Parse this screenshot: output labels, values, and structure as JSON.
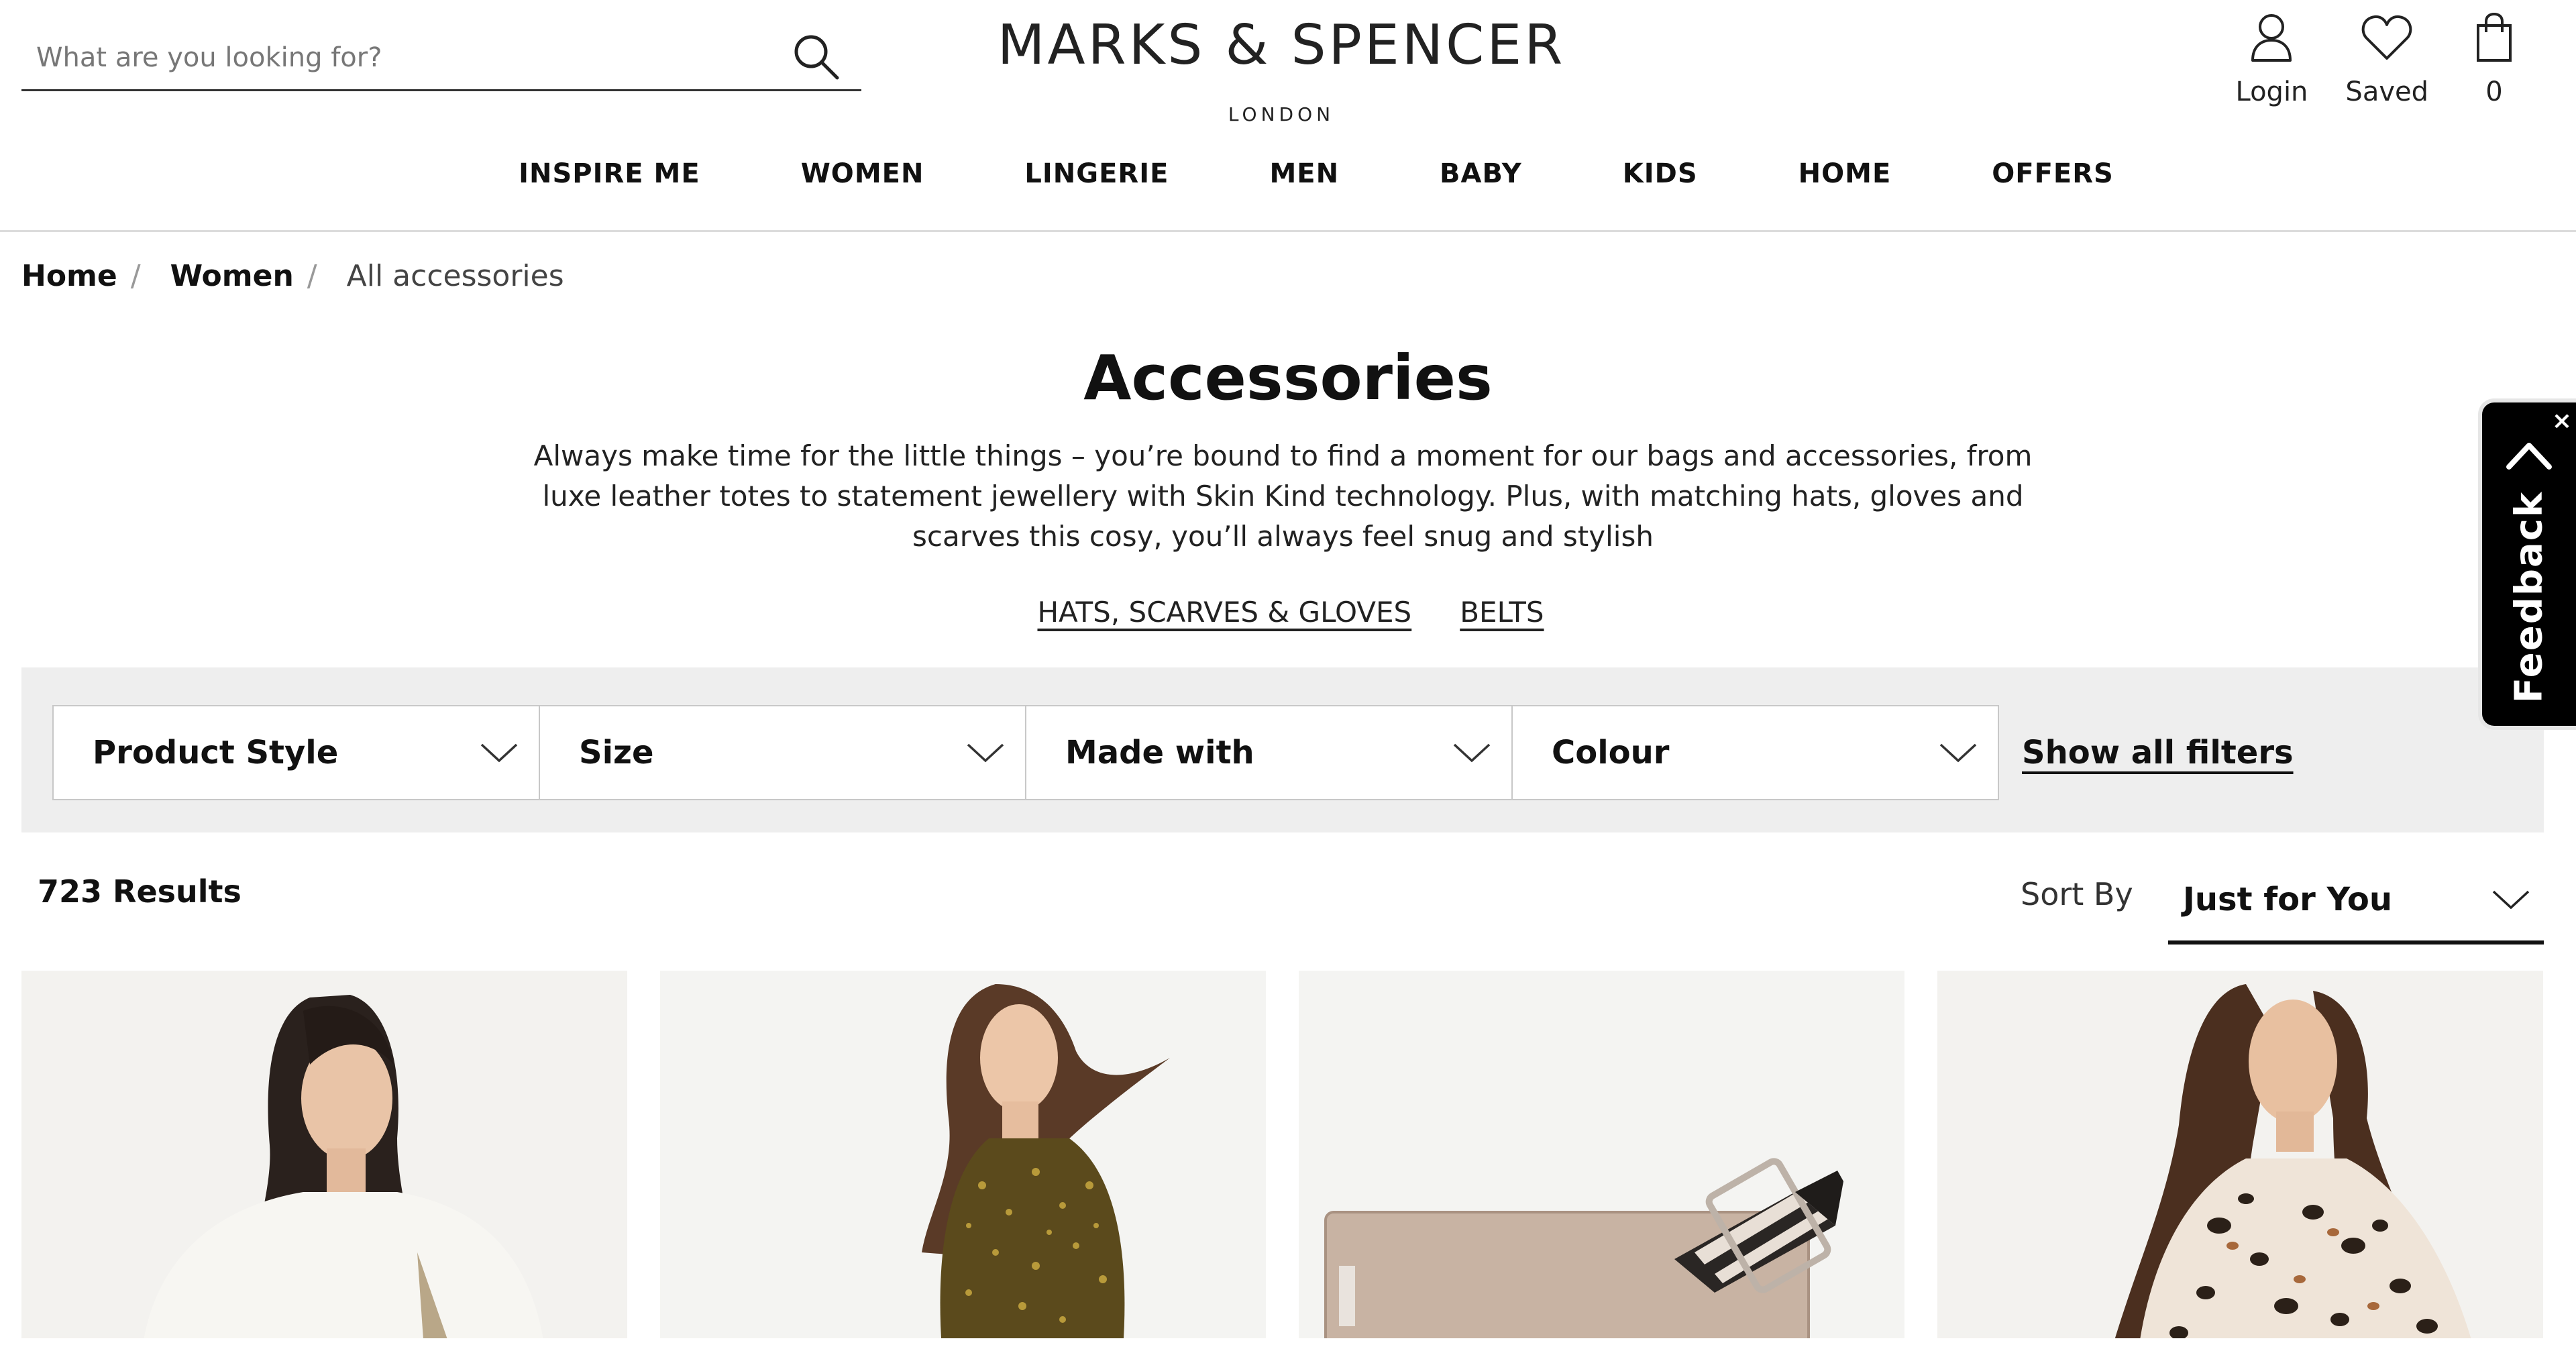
{
  "search": {
    "placeholder": "What are you looking for?"
  },
  "brand": {
    "name": "MARKS & SPENCER",
    "sub": "LONDON"
  },
  "utility": {
    "login": "Login",
    "saved": "Saved",
    "bag_count": "0"
  },
  "nav": [
    "INSPIRE ME",
    "WOMEN",
    "LINGERIE",
    "MEN",
    "BABY",
    "KIDS",
    "HOME",
    "OFFERS"
  ],
  "breadcrumb": {
    "home": "Home",
    "women": "Women",
    "current": "All accessories",
    "separator": "/"
  },
  "page": {
    "title": "Accessories",
    "description": "Always make time for the little things – you’re bound to find a moment for our bags and accessories, from luxe leather totes to statement jewellery with Skin Kind technology. Plus, with matching hats, gloves and scarves this cosy, you’ll always feel snug and stylish",
    "sub_links": [
      "HATS, SCARVES & GLOVES",
      "BELTS"
    ]
  },
  "filters": {
    "items": [
      "Product Style",
      "Size",
      "Made with",
      "Colour"
    ],
    "show_all": "Show all filters"
  },
  "results": {
    "count": "723 Results",
    "sort_label": "Sort By",
    "sort_value": "Just for You"
  },
  "feedback": {
    "label": "Feedback",
    "close": "×"
  },
  "products": [
    {
      "icon": "model-white-top-image"
    },
    {
      "icon": "model-leopard-dress-image"
    },
    {
      "icon": "crossbody-bag-image"
    },
    {
      "icon": "model-animal-print-blouse-image"
    }
  ]
}
